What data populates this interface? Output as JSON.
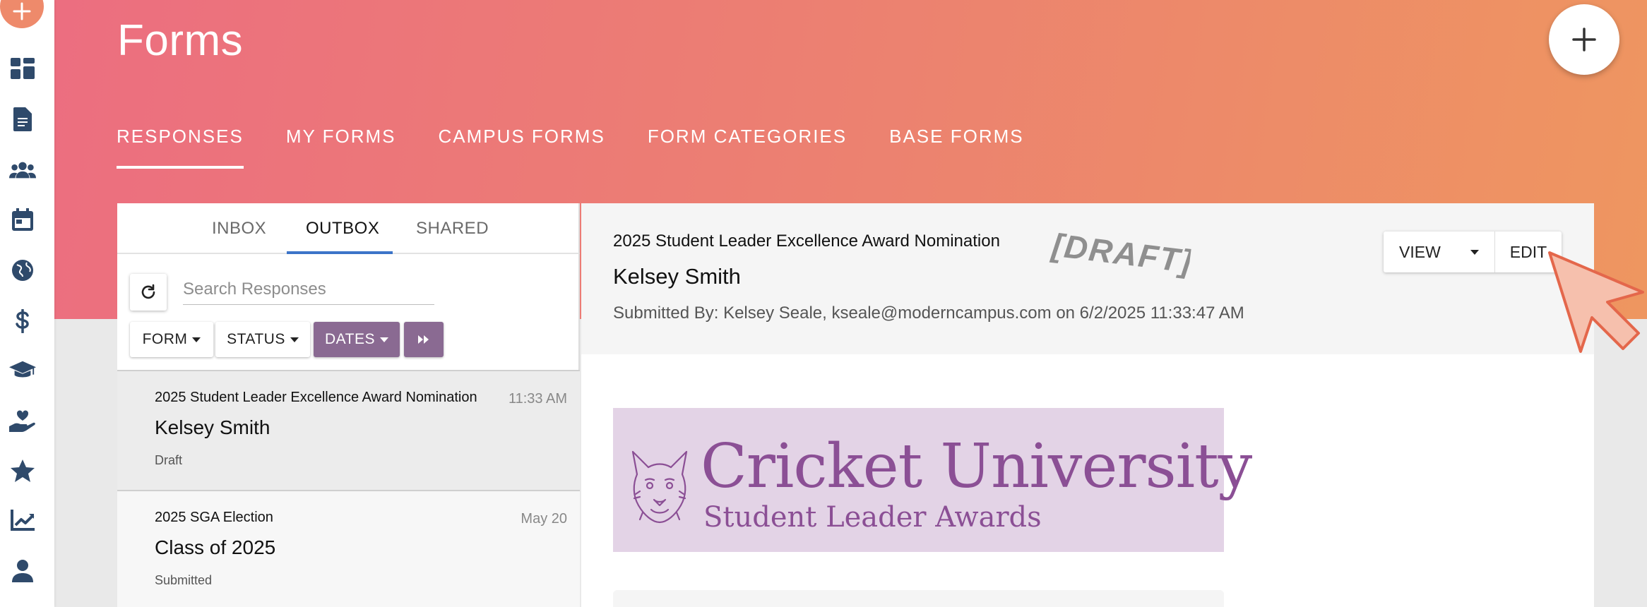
{
  "header": {
    "title": "Forms",
    "add_label": "+"
  },
  "top_tabs": [
    "RESPONSES",
    "MY FORMS",
    "CAMPUS FORMS",
    "FORM CATEGORIES",
    "BASE FORMS"
  ],
  "sub_tabs": [
    "INBOX",
    "OUTBOX",
    "SHARED"
  ],
  "search": {
    "placeholder": "Search Responses"
  },
  "filters": {
    "form": "FORM",
    "status": "STATUS",
    "dates": "DATES"
  },
  "responses": [
    {
      "form": "2025 Student Leader Excellence Award Nomination",
      "time": "11:33 AM",
      "name": "Kelsey Smith",
      "status": "Draft"
    },
    {
      "form": "2025 SGA Election",
      "time": "May 20",
      "name": "Class of 2025",
      "status": "Submitted"
    }
  ],
  "detail": {
    "form": "2025 Student Leader Excellence Award Nomination",
    "stamp": "[DRAFT]",
    "name": "Kelsey Smith",
    "submitted": "Submitted By: Kelsey Seale, kseale@moderncampus.com on 6/2/2025 11:33:47 AM",
    "view_label": "VIEW",
    "edit_label": "EDIT"
  },
  "banner": {
    "title": "Cricket University",
    "subtitle": "Student Leader Awards"
  },
  "colors": {
    "gradient_start": "#ec6e80",
    "gradient_end": "#ee9660",
    "accent_purple": "#8a6a92",
    "tab_underline": "#3c74c8",
    "banner_bg": "#e3d3e6",
    "banner_text": "#8b4f95"
  },
  "rail_icons": [
    "dashboard-icon",
    "document-icon",
    "users-icon",
    "calendar-icon",
    "globe-icon",
    "dollar-icon",
    "graduation-cap-icon",
    "hand-heart-icon",
    "star-icon",
    "chart-icon",
    "user-icon"
  ]
}
